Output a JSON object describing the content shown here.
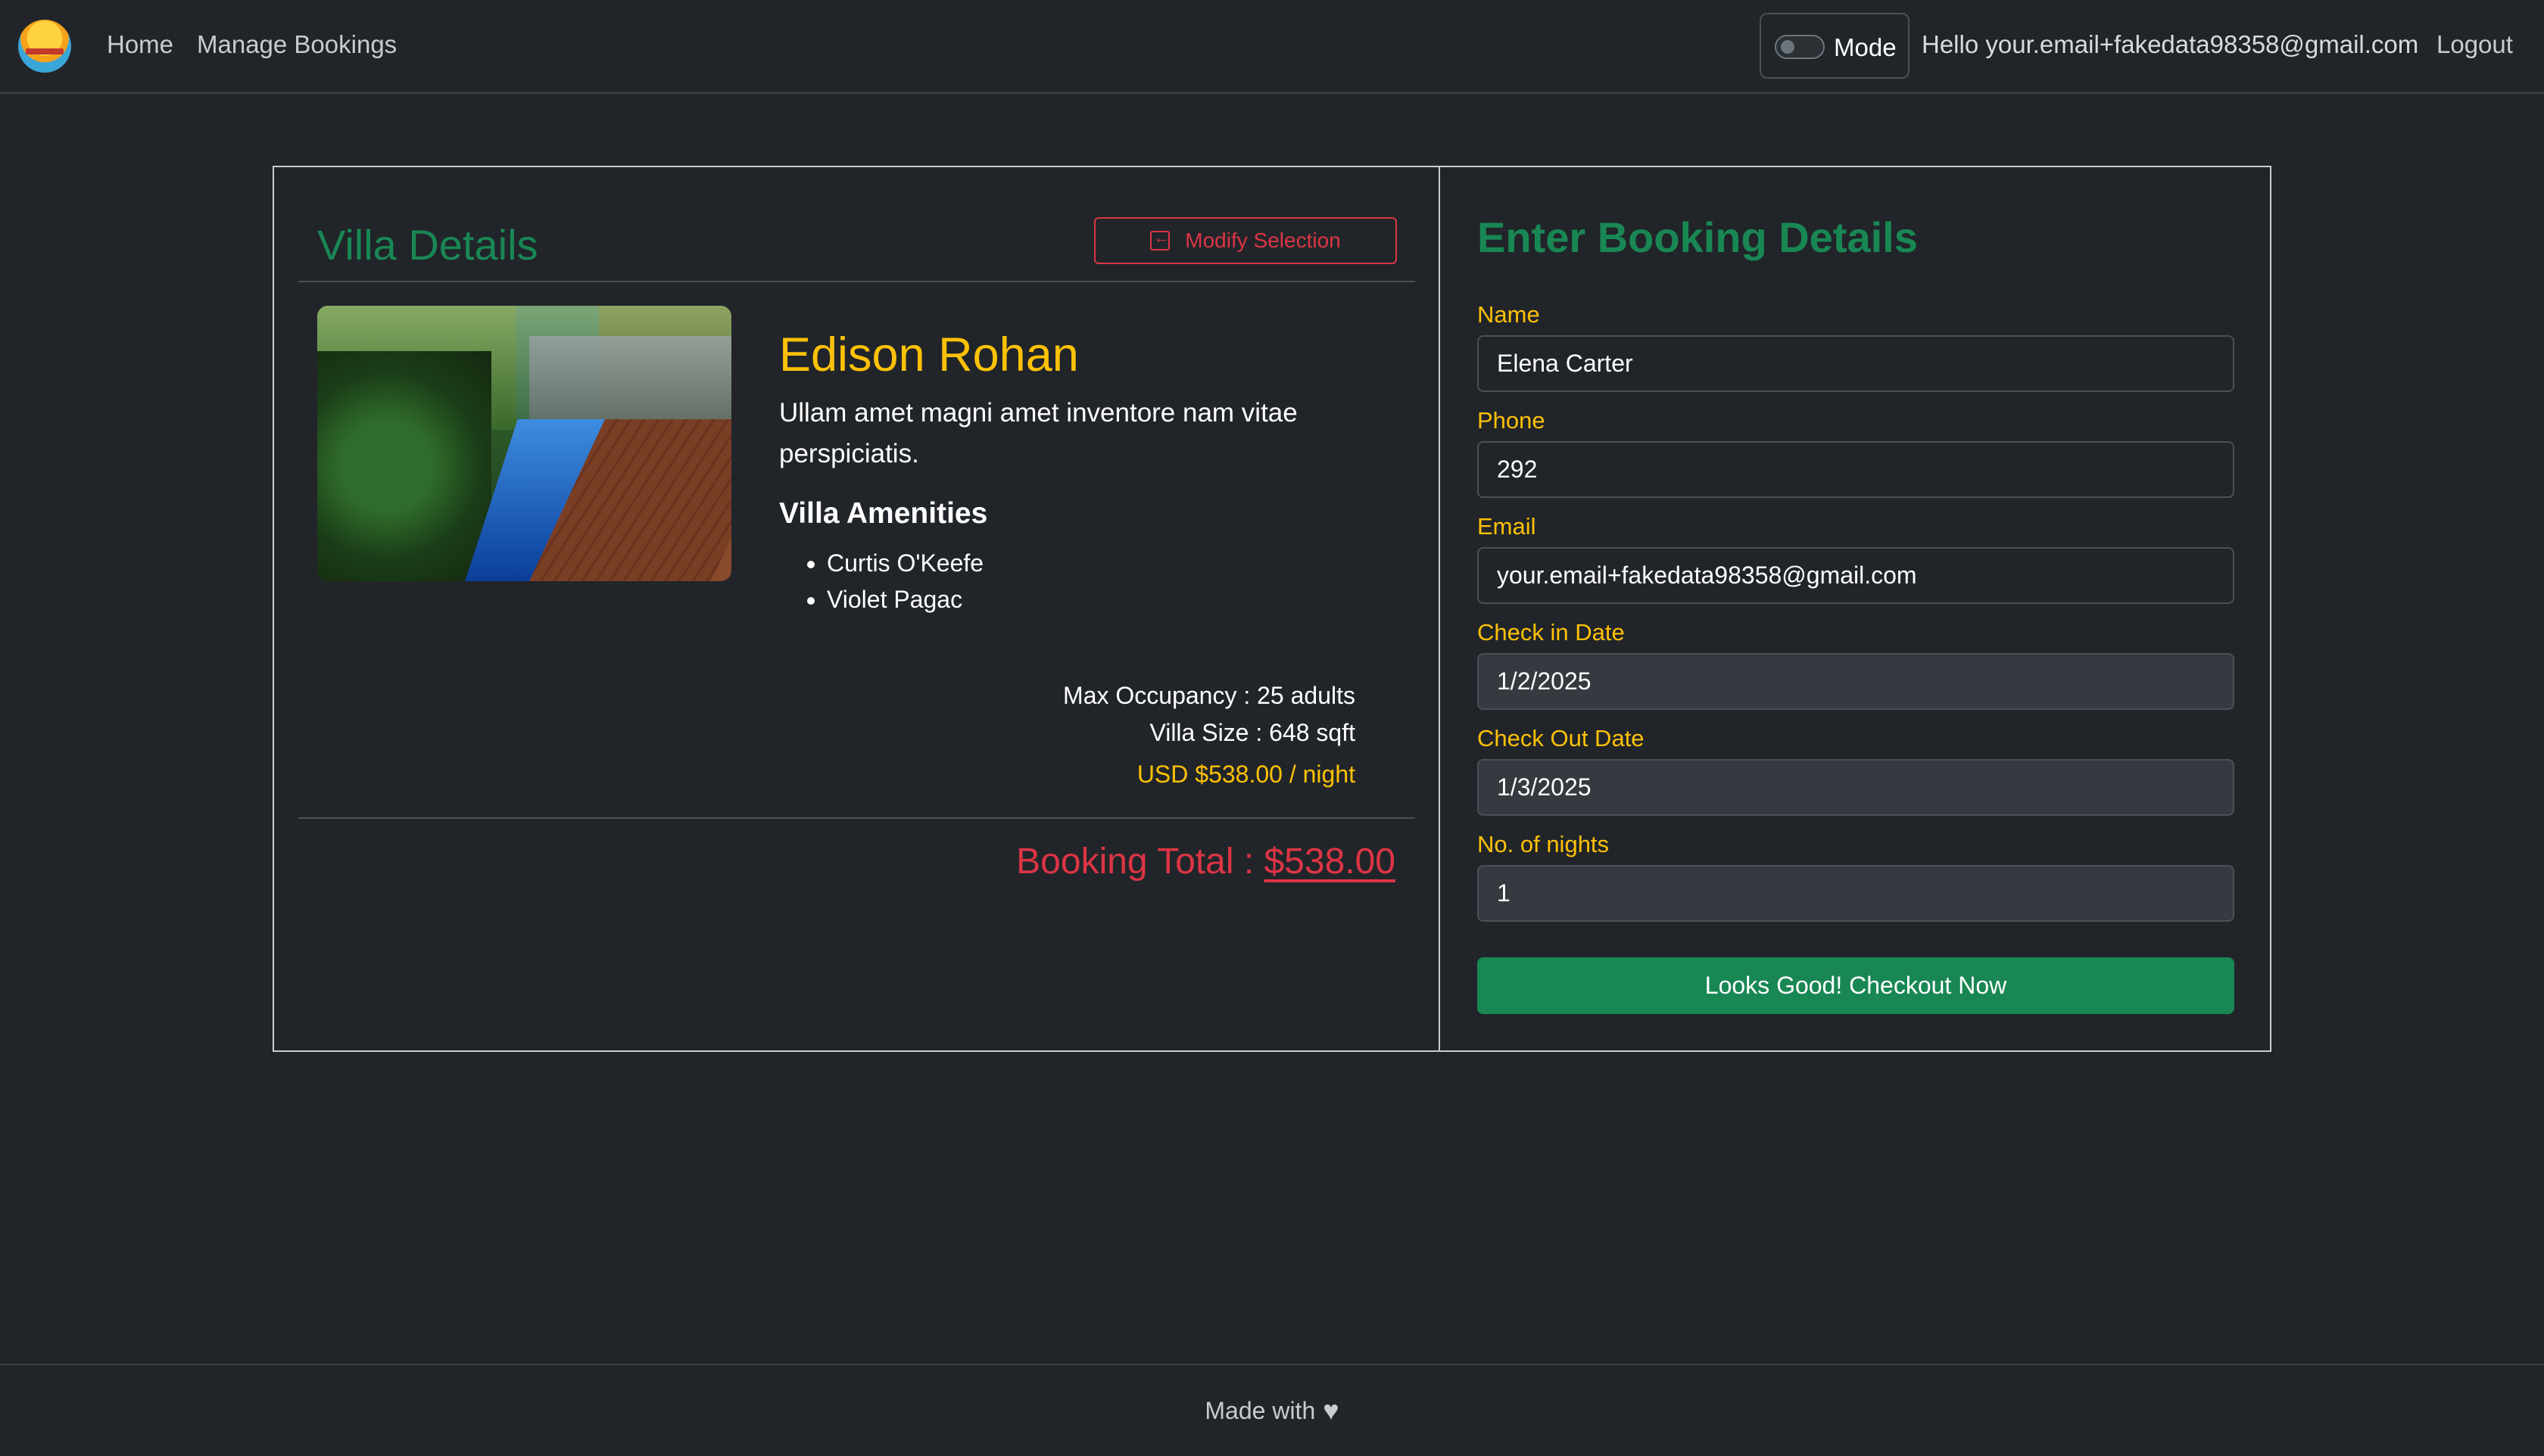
{
  "nav": {
    "home": "Home",
    "manage_bookings": "Manage Bookings",
    "mode_label": "Mode",
    "hello": "Hello your.email+fakedata98358@gmail.com",
    "logout": "Logout"
  },
  "villa": {
    "section_title": "Villa Details",
    "modify_label": "Modify Selection",
    "name": "Edison Rohan",
    "description": "Ullam amet magni amet inventore nam vitae perspiciatis.",
    "amenities_title": "Villa Amenities",
    "amenities": [
      "Curtis O'Keefe",
      "Violet Pagac"
    ],
    "max_occupancy": "Max Occupancy : 25 adults",
    "villa_size": "Villa Size : 648 sqft",
    "price_per_night": "USD $538.00 / night",
    "total_label": "Booking Total : ",
    "total_amount": "$538.00"
  },
  "form": {
    "title": "Enter Booking Details",
    "name_label": "Name",
    "name_value": "Elena Carter",
    "phone_label": "Phone",
    "phone_value": "292",
    "email_label": "Email",
    "email_value": "your.email+fakedata98358@gmail.com",
    "checkin_label": "Check in Date",
    "checkin_value": "1/2/2025",
    "checkout_label": "Check Out Date",
    "checkout_value": "1/3/2025",
    "nights_label": "No. of nights",
    "nights_value": "1",
    "submit_label": "Looks Good! Checkout Now"
  },
  "footer": {
    "text": "Made with",
    "icon": "heart-icon"
  },
  "colors": {
    "background": "#212529",
    "accent_green": "#198754",
    "accent_yellow": "#ffc107",
    "accent_red": "#dc3545"
  }
}
